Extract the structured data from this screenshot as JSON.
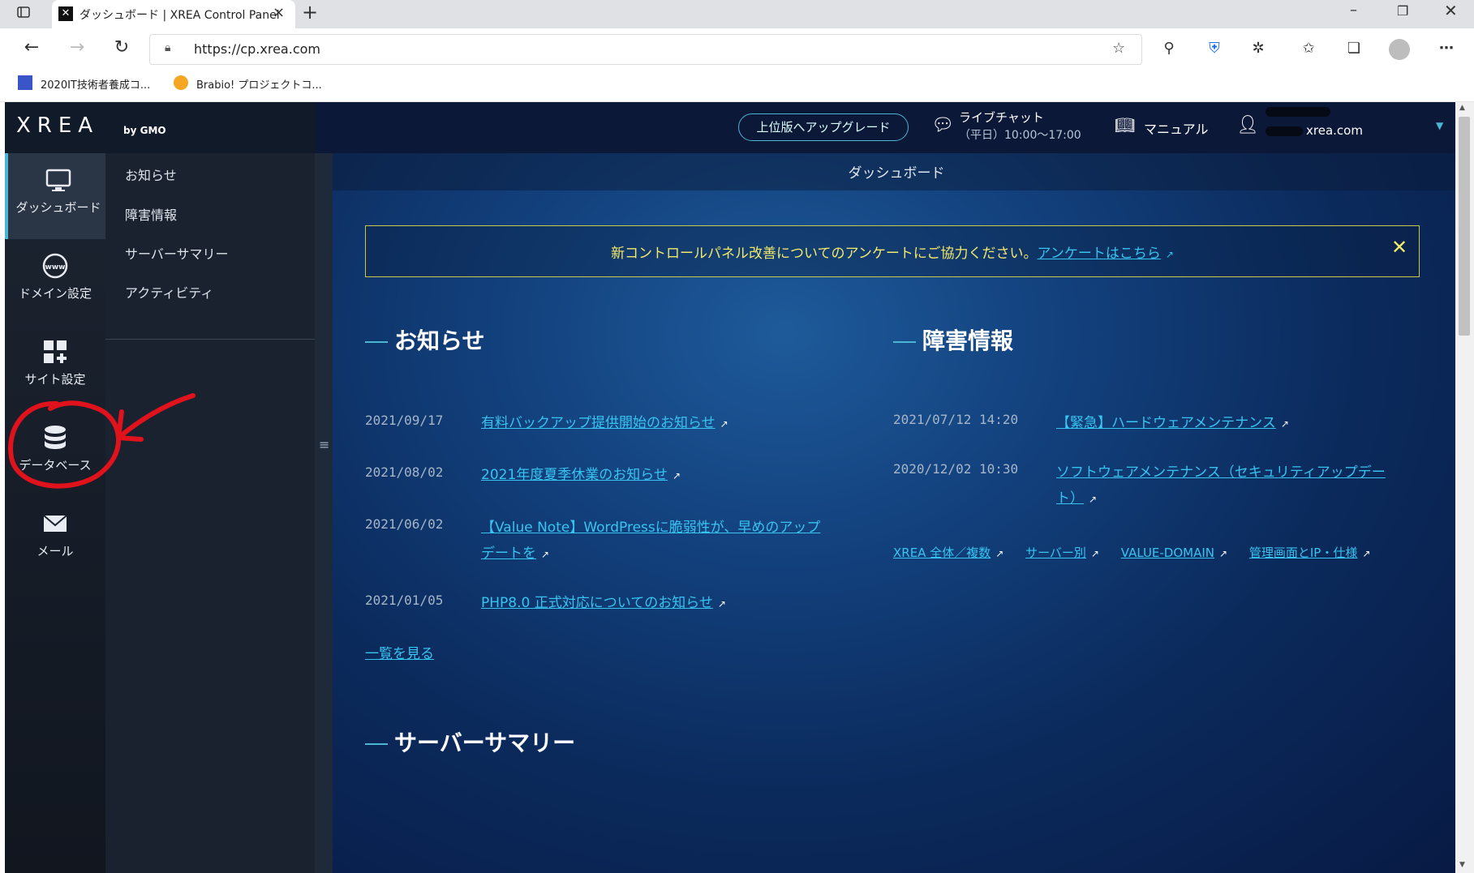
{
  "browser": {
    "tab_title": "ダッシュボード | XREA Control Panel",
    "url": "https://cp.xrea.com",
    "bookmarks": [
      {
        "label": "2020IT技術者養成コ..."
      },
      {
        "label": "Brabio! プロジェクトコ..."
      }
    ]
  },
  "header": {
    "logo": "XREA",
    "logo_by": "by GMO",
    "upgrade_button": "上位版へアップグレード",
    "live_chat_title": "ライブチャット",
    "live_chat_hours": "（平日）10:00〜17:00",
    "manual_label": "マニュアル",
    "account_domain": "xrea.com"
  },
  "leftnav": [
    {
      "label": "ダッシュボード",
      "icon": "monitor-icon"
    },
    {
      "label": "ドメイン設定",
      "icon": "www-globe-icon"
    },
    {
      "label": "サイト設定",
      "icon": "grid-plus-icon"
    },
    {
      "label": "データベース",
      "icon": "database-icon"
    },
    {
      "label": "メール",
      "icon": "mail-icon"
    }
  ],
  "subnav": [
    "お知らせ",
    "障害情報",
    "サーバーサマリー",
    "アクティビティ"
  ],
  "main": {
    "page_title": "ダッシュボード",
    "notice_text": "新コントロールパネル改善についてのアンケートにご協力ください。",
    "notice_link": "アンケートはこちら",
    "news_heading": "お知らせ",
    "news": [
      {
        "date": "2021/09/17",
        "title": "有料バックアップ提供開始のお知らせ"
      },
      {
        "date": "2021/08/02",
        "title": "2021年度夏季休業のお知らせ"
      },
      {
        "date": "2021/06/02",
        "title": "【Value Note】WordPressに脆弱性が、早めのアップデートを"
      },
      {
        "date": "2021/01/05",
        "title": "PHP8.0 正式対応についてのお知らせ"
      }
    ],
    "news_more": "一覧を見る",
    "incident_heading": "障害情報",
    "incidents": [
      {
        "date": "2021/07/12 14:20",
        "title": "【緊急】ハードウェアメンテナンス"
      },
      {
        "date": "2020/12/02 10:30",
        "title": "ソフトウェアメンテナンス（セキュリティアップデート）"
      }
    ],
    "incident_links": [
      "XREA 全体／複数",
      "サーバー別",
      "VALUE-DOMAIN",
      "管理画面とIP・仕様"
    ],
    "summary_heading": "サーバーサマリー"
  },
  "colors": {
    "accent": "#38c4f0",
    "notice": "#f3e96a",
    "annotation": "#e0121b"
  }
}
